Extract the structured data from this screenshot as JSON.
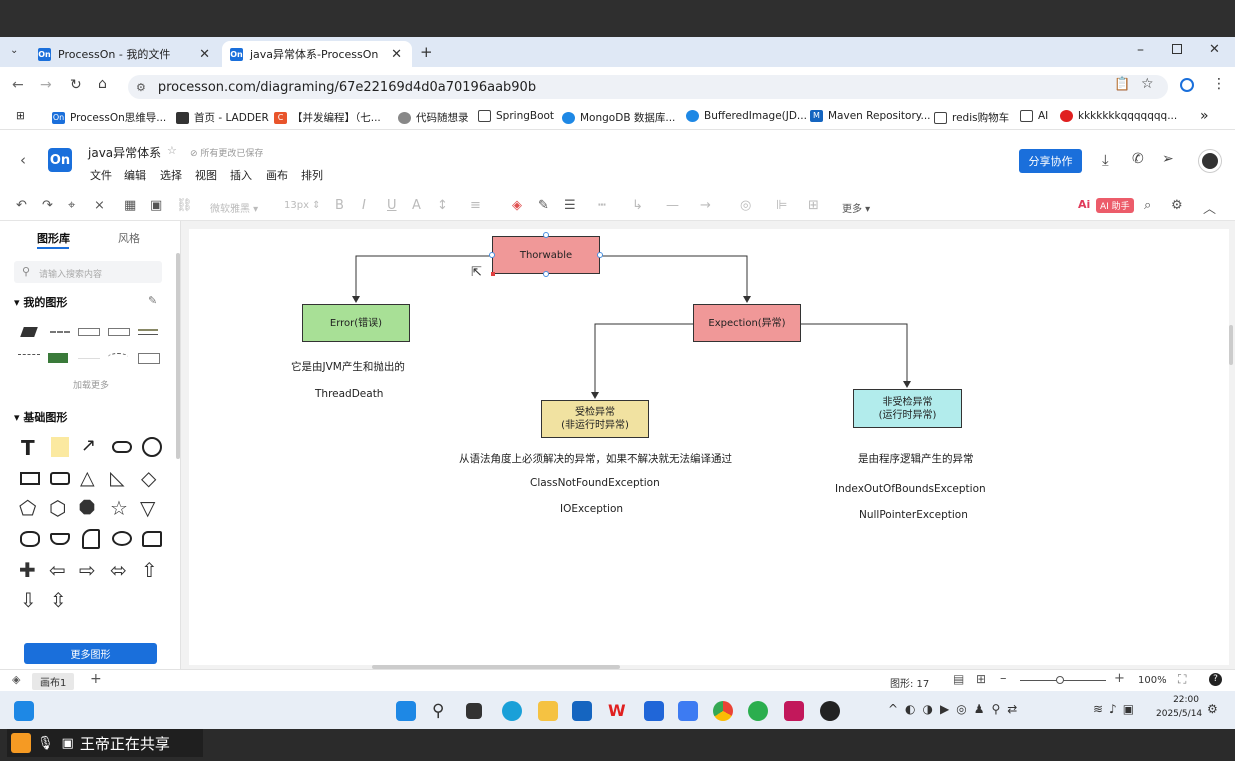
{
  "browser": {
    "tabs": [
      {
        "label": "ProcessOn - 我的文件",
        "favicon": "On"
      },
      {
        "label": "java异常体系-ProcessOn",
        "favicon": "On"
      }
    ],
    "url": "processon.com/diagraming/67e22169d4d0a70196aab90b",
    "bookmarks": [
      "ProcessOn思维导...",
      "首页 - LADDER",
      "【并发编程】（七...",
      "代码随想录",
      "SpringBoot",
      "MongoDB 数据库...",
      "BufferedImage(JD...",
      "Maven Repository...",
      "redis购物车",
      "AI",
      "kkkkkkkqqqqqqq..."
    ],
    "more_bookmarks": "»"
  },
  "app": {
    "logo": "On",
    "doc_title": "java异常体系",
    "save_status": "所有更改已保存",
    "menus": [
      "文件",
      "编辑",
      "选择",
      "视图",
      "插入",
      "画布",
      "排列"
    ],
    "share_label": "分享协作",
    "toolbar": {
      "font": "微软雅黑",
      "font_size": "13px",
      "more": "更多",
      "ai": "AI 助手"
    }
  },
  "sidebar": {
    "tabs": [
      "图形库",
      "风格"
    ],
    "search_placeholder": "请输入搜索内容",
    "my_shapes": "我的图形",
    "load_more": "加载更多",
    "basic_shapes": "基础图形",
    "more_shapes": "更多图形"
  },
  "diagram": {
    "nodes": {
      "throwable": "Thorwable",
      "error": "Error(错误)",
      "exception": "Expection(异常)",
      "checked_l1": "受检异常",
      "checked_l2": "(非运行时异常)",
      "unchecked_l1": "非受检异常",
      "unchecked_l2": "(运行时异常)"
    },
    "texts": {
      "error_desc": "它是由JVM产生和抛出的",
      "thread_death": "ThreadDeath",
      "checked_desc": "从语法角度上必须解决的异常，如果不解决就无法编译通过",
      "class_not_found": "ClassNotFoundException",
      "io_exception": "IOException",
      "unchecked_desc": "是由程序逻辑产生的异常",
      "index_oob": "IndexOutOfBoundsException",
      "null_pointer": "NullPointerException"
    },
    "colors": {
      "throwable": "#f09898",
      "error": "#a8e096",
      "exception": "#f09898",
      "checked": "#f1e2a1",
      "unchecked": "#b2ecec"
    }
  },
  "status": {
    "page_tab": "画布1",
    "add": "+",
    "shape_count": "图形: 17",
    "zoom": "100%"
  },
  "taskbar": {
    "time": "22:00",
    "date": "2025/5/14"
  },
  "screenshare": {
    "text": "王帝正在共享"
  }
}
